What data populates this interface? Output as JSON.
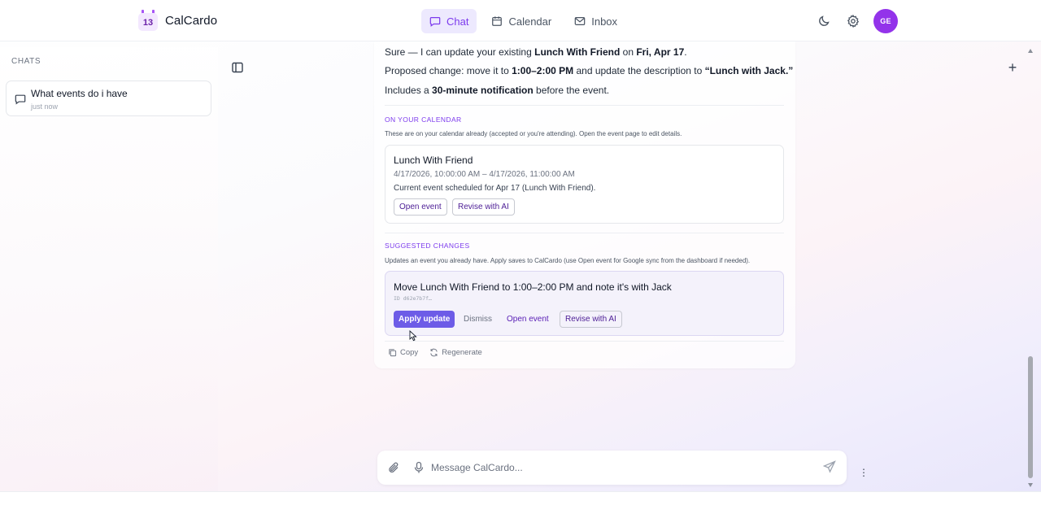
{
  "app": {
    "brand": "CalCardo",
    "logo_day": "13",
    "nav": [
      {
        "label": "Chat",
        "icon": "chat-bubble-icon",
        "active": true
      },
      {
        "label": "Calendar",
        "icon": "calendar-icon",
        "active": false
      },
      {
        "label": "Inbox",
        "icon": "mail-icon",
        "active": false
      }
    ],
    "avatar_initials": "GE",
    "accent_color": "#7c3aed",
    "primary_button_color": "#6d5ce7"
  },
  "sidebar": {
    "heading": "CHATS",
    "chats": [
      {
        "title": "What events do i have",
        "time": "just now"
      }
    ]
  },
  "message": {
    "line1": {
      "p1": "Sure — I can update your existing ",
      "b1": "Lunch With Friend",
      "p2": " on ",
      "b2": "Fri, Apr 17",
      "p3": "."
    },
    "line2": {
      "p1": "Proposed change: move it to ",
      "b1": "1:00–2:00 PM",
      "p2": " and update the description to ",
      "b2": "“Lunch with Jack.”"
    },
    "line3": {
      "p1": "Includes a ",
      "b1": "30-minute notification",
      "p2": " before the event."
    },
    "calendar_section": {
      "title": "ON YOUR CALENDAR",
      "note": "These are on your calendar already (accepted or you're attending). Open the event page to edit details.",
      "event": {
        "title": "Lunch With Friend",
        "time": "4/17/2026, 10:00:00 AM – 4/17/2026, 11:00:00 AM",
        "description": "Current event scheduled for Apr 17 (Lunch With Friend).",
        "open_label": "Open event",
        "revise_label": "Revise with AI"
      }
    },
    "suggested_section": {
      "title": "SUGGESTED CHANGES",
      "note": "Updates an event you already have. Apply saves to CalCardo (use Open event for Google sync from the dashboard if needed).",
      "change": {
        "title": "Move Lunch With Friend to 1:00–2:00 PM and note it's with Jack",
        "id": "ID d62e7b7f…",
        "apply_label": "Apply update",
        "dismiss_label": "Dismiss",
        "open_label": "Open event",
        "revise_label": "Revise with AI"
      }
    },
    "actions": {
      "copy": "Copy",
      "regenerate": "Regenerate"
    }
  },
  "composer": {
    "placeholder": "Message CalCardo..."
  }
}
